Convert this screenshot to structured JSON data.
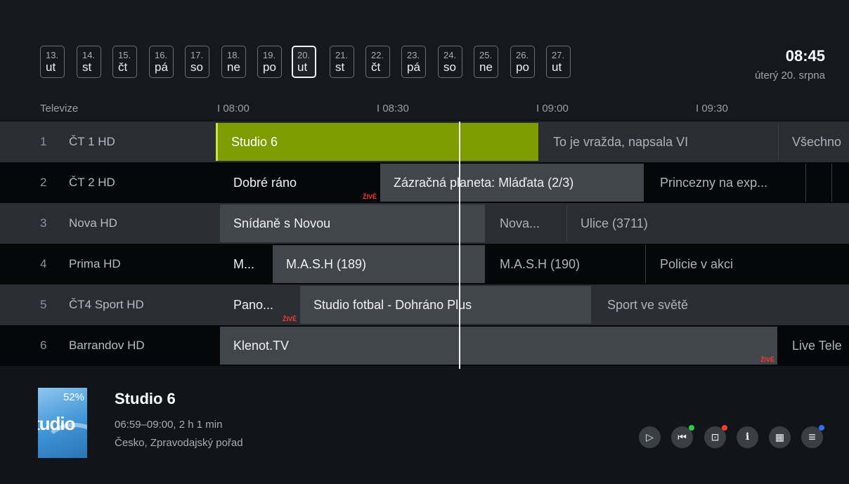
{
  "dates": [
    {
      "num": "13.",
      "day": "ut"
    },
    {
      "num": "14.",
      "day": "st"
    },
    {
      "num": "15.",
      "day": "čt"
    },
    {
      "num": "16.",
      "day": "pá"
    },
    {
      "num": "17.",
      "day": "so"
    },
    {
      "num": "18.",
      "day": "ne"
    },
    {
      "num": "19.",
      "day": "po"
    },
    {
      "num": "20.",
      "day": "ut"
    },
    {
      "num": "21.",
      "day": "st"
    },
    {
      "num": "22.",
      "day": "čt"
    },
    {
      "num": "23.",
      "day": "pá"
    },
    {
      "num": "24.",
      "day": "so"
    },
    {
      "num": "25.",
      "day": "ne"
    },
    {
      "num": "26.",
      "day": "po"
    },
    {
      "num": "27.",
      "day": "ut"
    }
  ],
  "selected_date": "20.",
  "clock": {
    "time": "08:45",
    "date": "úterý 20. srpna"
  },
  "header": {
    "column_label": "Televize",
    "time_ticks": [
      "I 08:00",
      "I 08:30",
      "I 09:00",
      "I 09:30"
    ]
  },
  "live_badge": "ŽIVĚ",
  "channels": [
    {
      "num": "1",
      "name": "ČT 1 HD",
      "programs": [
        {
          "title": "Studio 6",
          "state": "current"
        },
        {
          "title": "To je vražda, napsala VI",
          "state": "dim"
        },
        {
          "title": "Všechno",
          "state": "dim"
        }
      ]
    },
    {
      "num": "2",
      "name": "ČT 2 HD",
      "programs": [
        {
          "title": "Dobré ráno",
          "state": "plain",
          "live": true
        },
        {
          "title": "Zázračná planeta: Mláďata (2/3)",
          "state": "lit"
        },
        {
          "title": "Princezny na exp...",
          "state": "dim"
        },
        {
          "title": "",
          "state": "dim"
        },
        {
          "title": "",
          "state": "dim"
        }
      ]
    },
    {
      "num": "3",
      "name": "Nova HD",
      "programs": [
        {
          "title": "Snídaně s Novou",
          "state": "lit"
        },
        {
          "title": "Nova...",
          "state": "dim"
        },
        {
          "title": "Ulice (3711)",
          "state": "dim"
        }
      ]
    },
    {
      "num": "4",
      "name": "Prima HD",
      "programs": [
        {
          "title": "M...",
          "state": "plain"
        },
        {
          "title": "M.A.S.H (189)",
          "state": "lit"
        },
        {
          "title": "M.A.S.H (190)",
          "state": "dim"
        },
        {
          "title": "Policie v akci",
          "state": "dim"
        }
      ]
    },
    {
      "num": "5",
      "name": "ČT4 Sport HD",
      "programs": [
        {
          "title": "Pano...",
          "state": "plain",
          "live": true
        },
        {
          "title": "Studio fotbal - Dohráno Plus",
          "state": "lit"
        },
        {
          "title": "Sport ve světě",
          "state": "dim"
        }
      ]
    },
    {
      "num": "6",
      "name": "Barrandov HD",
      "programs": [
        {
          "title": "Klenot.TV",
          "state": "lit",
          "live": true
        },
        {
          "title": "Live Tele",
          "state": "dim"
        }
      ]
    }
  ],
  "detail": {
    "title": "Studio 6",
    "time": "06:59–09:00, 2 h 1 min",
    "description": "Česko, Zpravodajský pořad",
    "progress_percent": 52,
    "progress_label": "52%",
    "thumb_text": "tudio"
  },
  "controls": [
    {
      "icon": "play-icon",
      "glyph": "▷"
    },
    {
      "icon": "restart-icon",
      "glyph": "⏮",
      "dot": "#2ecc40"
    },
    {
      "icon": "record-icon",
      "glyph": "⊡",
      "dot": "#ff3b30"
    },
    {
      "icon": "info-icon",
      "glyph": "i"
    },
    {
      "icon": "calendar-icon",
      "glyph": "▦"
    },
    {
      "icon": "menu-icon",
      "glyph": "≡",
      "dot": "#2f6fff"
    }
  ]
}
